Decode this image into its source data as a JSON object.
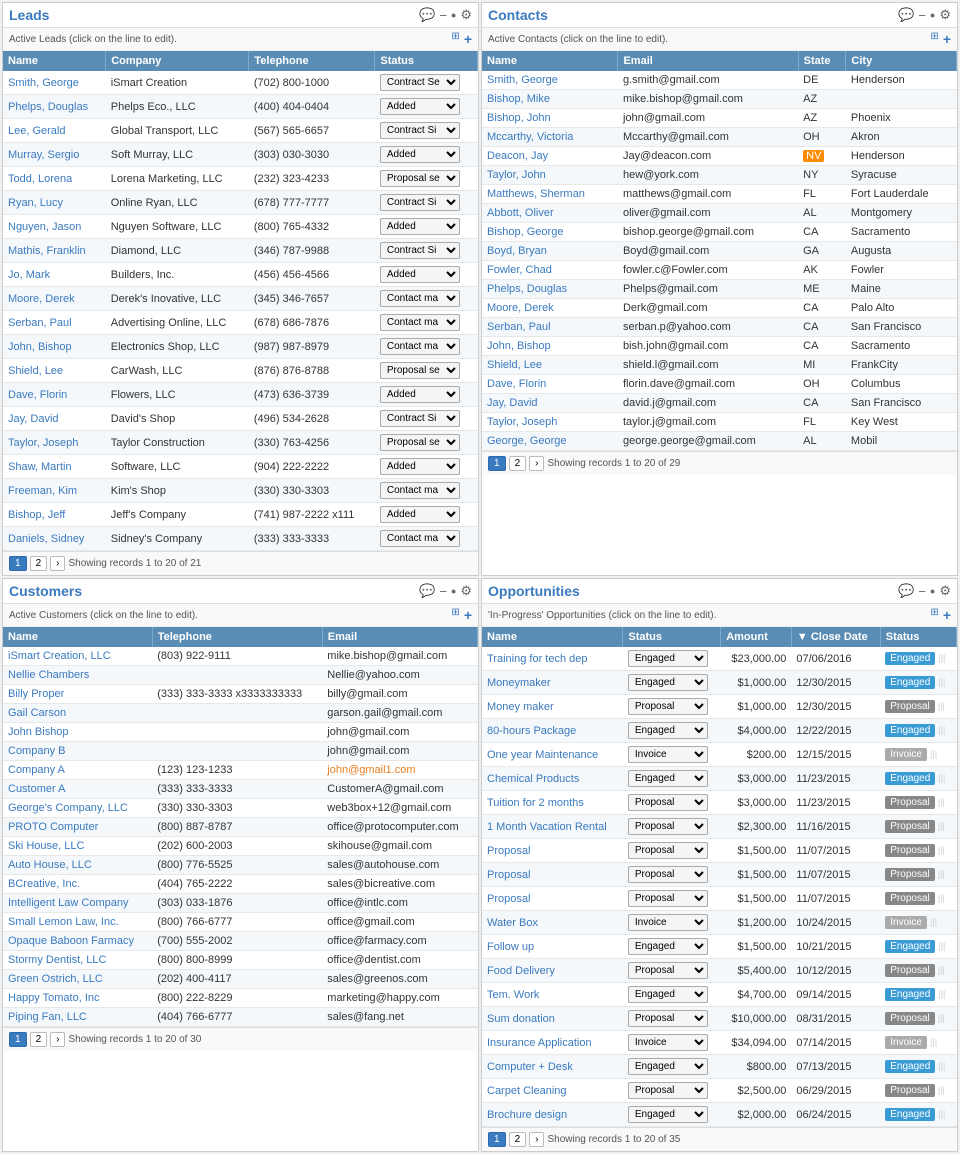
{
  "leads": {
    "title": "Leads",
    "subtitle": "Active Leads (click on the line to edit).",
    "columns": [
      "Name",
      "Company",
      "Telephone",
      "Status"
    ],
    "rows": [
      [
        "Smith, George",
        "iSmart Creation",
        "(702) 800-1000",
        "Contract Se"
      ],
      [
        "Phelps, Douglas",
        "Phelps Eco., LLC",
        "(400) 404-0404",
        "Added"
      ],
      [
        "Lee, Gerald",
        "Global Transport, LLC",
        "(567) 565-6657",
        "Contract Si"
      ],
      [
        "Murray, Sergio",
        "Soft Murray, LLC",
        "(303) 030-3030",
        "Added"
      ],
      [
        "Todd, Lorena",
        "Lorena Marketing, LLC",
        "(232) 323-4233",
        "Proposal se"
      ],
      [
        "Ryan, Lucy",
        "Online Ryan, LLC",
        "(678) 777-7777",
        "Contract Si"
      ],
      [
        "Nguyen, Jason",
        "Nguyen Software, LLC",
        "(800) 765-4332",
        "Added"
      ],
      [
        "Mathis, Franklin",
        "Diamond, LLC",
        "(346) 787-9988",
        "Contract Si"
      ],
      [
        "Jo, Mark",
        "Builders, Inc.",
        "(456) 456-4566",
        "Added"
      ],
      [
        "Moore, Derek",
        "Derek's Inovative, LLC",
        "(345) 346-7657",
        "Contact ma"
      ],
      [
        "Serban, Paul",
        "Advertising Online, LLC",
        "(678) 686-7876",
        "Contact ma"
      ],
      [
        "John, Bishop",
        "Electronics Shop, LLC",
        "(987) 987-8979",
        "Contact ma"
      ],
      [
        "Shield, Lee",
        "CarWash, LLC",
        "(876) 876-8788",
        "Proposal se"
      ],
      [
        "Dave, Florin",
        "Flowers, LLC",
        "(473) 636-3739",
        "Added"
      ],
      [
        "Jay, David",
        "David's Shop",
        "(496) 534-2628",
        "Contract Si"
      ],
      [
        "Taylor, Joseph",
        "Taylor Construction",
        "(330) 763-4256",
        "Proposal se"
      ],
      [
        "Shaw, Martin",
        "Software, LLC",
        "(904) 222-2222",
        "Added"
      ],
      [
        "Freeman, Kim",
        "Kim's Shop",
        "(330) 330-3303",
        "Contact ma"
      ],
      [
        "Bishop, Jeff",
        "Jeff's Company",
        "(741) 987-2222 x111",
        "Added"
      ],
      [
        "Daniels, Sidney",
        "Sidney's Company",
        "(333) 333-3333",
        "Contact ma"
      ]
    ],
    "pagination": "Showing records 1 to 20 of 21"
  },
  "contacts": {
    "title": "Contacts",
    "subtitle": "Active Contacts (click on the line to edit).",
    "columns": [
      "Name",
      "Email",
      "State",
      "City"
    ],
    "rows": [
      [
        "Smith, George",
        "g.smith@gmail.com",
        "DE",
        "Henderson"
      ],
      [
        "Bishop, Mike",
        "mike.bishop@gmail.com",
        "AZ",
        ""
      ],
      [
        "Bishop, John",
        "john@gmail.com",
        "AZ",
        "Phoenix"
      ],
      [
        "Mccarthy, Victoria",
        "Mccarthy@gmail.com",
        "OH",
        "Akron"
      ],
      [
        "Deacon, Jay",
        "Jay@deacon.com",
        "NV",
        "Henderson"
      ],
      [
        "Taylor, John",
        "hew@york.com",
        "NY",
        "Syracuse"
      ],
      [
        "Matthews, Sherman",
        "matthews@gmail.com",
        "FL",
        "Fort Lauderdale"
      ],
      [
        "Abbott, Oliver",
        "oliver@gmail.com",
        "AL",
        "Montgomery"
      ],
      [
        "Bishop, George",
        "bishop.george@gmail.com",
        "CA",
        "Sacramento"
      ],
      [
        "Boyd, Bryan",
        "Boyd@gmail.com",
        "GA",
        "Augusta"
      ],
      [
        "Fowler, Chad",
        "fowler.c@Fowler.com",
        "AK",
        "Fowler"
      ],
      [
        "Phelps, Douglas",
        "Phelps@gmail.com",
        "ME",
        "Maine"
      ],
      [
        "Moore, Derek",
        "Derk@gmail.com",
        "CA",
        "Palo Alto"
      ],
      [
        "Serban, Paul",
        "serban.p@yahoo.com",
        "CA",
        "San Francisco"
      ],
      [
        "John, Bishop",
        "bish.john@gmail.com",
        "CA",
        "Sacramento"
      ],
      [
        "Shield, Lee",
        "shield.l@gmail.com",
        "MI",
        "FrankCity"
      ],
      [
        "Dave, Florin",
        "florin.dave@gmail.com",
        "OH",
        "Columbus"
      ],
      [
        "Jay, David",
        "david.j@gmail.com",
        "CA",
        "San Francisco"
      ],
      [
        "Taylor, Joseph",
        "taylor.j@gmail.com",
        "FL",
        "Key West"
      ],
      [
        "George, George",
        "george.george@gmail.com",
        "AL",
        "Mobil"
      ]
    ],
    "pagination": "Showing records 1 to 20 of 29"
  },
  "customers": {
    "title": "Customers",
    "subtitle": "Active Customers (click on the line to edit).",
    "columns": [
      "Name",
      "Telephone",
      "Email"
    ],
    "rows": [
      [
        "iSmart Creation, LLC",
        "(803) 922-9111",
        "mike.bishop@gmail.com"
      ],
      [
        "Nellie Chambers",
        "",
        "Nellie@yahoo.com"
      ],
      [
        "Billy Proper",
        "(333) 333-3333 x3333333333",
        "billy@gmail.com"
      ],
      [
        "Gail Carson",
        "",
        "garson.gail@gmail.com"
      ],
      [
        "John Bishop",
        "",
        "john@gmail.com"
      ],
      [
        "Company B",
        "",
        "john@gmail.com"
      ],
      [
        "Company A",
        "(123) 123-1233",
        "john@gmail1.com"
      ],
      [
        "Customer A",
        "(333) 333-3333",
        "CustomerA@gmail.com"
      ],
      [
        "George's Company, LLC",
        "(330) 330-3303",
        "web3box+12@gmail.com"
      ],
      [
        "PROTO Computer",
        "(800) 887-8787",
        "office@protocomputer.com"
      ],
      [
        "Ski House, LLC",
        "(202) 600-2003",
        "skihouse@gmail.com"
      ],
      [
        "Auto House, LLC",
        "(800) 776-5525",
        "sales@autohouse.com"
      ],
      [
        "BCreative, Inc.",
        "(404) 765-2222",
        "sales@bicreative.com"
      ],
      [
        "Intelligent Law Company",
        "(303) 033-1876",
        "office@intlc.com"
      ],
      [
        "Small Lemon Law, Inc.",
        "(800) 766-6777",
        "office@gmail.com"
      ],
      [
        "Opaque Baboon Farmacy",
        "(700) 555-2002",
        "office@farmacy.com"
      ],
      [
        "Stormy Dentist, LLC",
        "(800) 800-8999",
        "office@dentist.com"
      ],
      [
        "Green Ostrich, LLC",
        "(202) 400-4117",
        "sales@greenos.com"
      ],
      [
        "Happy Tomato, Inc",
        "(800) 222-8229",
        "marketing@happy.com"
      ],
      [
        "Piping Fan, LLC",
        "(404) 766-6777",
        "sales@fang.net"
      ]
    ],
    "pagination": "Showing records 1 to 20 of 30"
  },
  "opportunities": {
    "title": "Opportunities",
    "subtitle": "'In-Progress' Opportunities (click on the line to edit).",
    "columns": [
      "Name",
      "Status",
      "Amount",
      "Close Date",
      "Status"
    ],
    "rows": [
      [
        "Training for tech dep",
        "Engaged",
        "$23,000.00",
        "07/06/2016",
        "Engaged"
      ],
      [
        "Moneymaker",
        "Engaged",
        "$1,000.00",
        "12/30/2015",
        "Engaged"
      ],
      [
        "Money maker",
        "Proposal",
        "$1,000.00",
        "12/30/2015",
        "Proposal"
      ],
      [
        "80-hours Package",
        "Engaged",
        "$4,000.00",
        "12/22/2015",
        "Engaged"
      ],
      [
        "One year Maintenance",
        "Invoice",
        "$200.00",
        "12/15/2015",
        "Invoice"
      ],
      [
        "Chemical Products",
        "Engaged",
        "$3,000.00",
        "11/23/2015",
        "Engaged"
      ],
      [
        "Tuition for 2 months",
        "Proposal",
        "$3,000.00",
        "11/23/2015",
        "Proposal"
      ],
      [
        "1 Month Vacation Rental",
        "Proposal",
        "$2,300.00",
        "11/16/2015",
        "Proposal"
      ],
      [
        "Proposal",
        "Proposal",
        "$1,500.00",
        "11/07/2015",
        "Proposal"
      ],
      [
        "Proposal",
        "Proposal",
        "$1,500.00",
        "11/07/2015",
        "Proposal"
      ],
      [
        "Proposal",
        "Proposal",
        "$1,500.00",
        "11/07/2015",
        "Proposal"
      ],
      [
        "Water Box",
        "Invoice",
        "$1,200.00",
        "10/24/2015",
        "Invoice"
      ],
      [
        "Follow up",
        "Engaged",
        "$1,500.00",
        "10/21/2015",
        "Engaged"
      ],
      [
        "Food Delivery",
        "Proposal",
        "$5,400.00",
        "10/12/2015",
        "Proposal"
      ],
      [
        "Tem. Work",
        "Engaged",
        "$4,700.00",
        "09/14/2015",
        "Engaged"
      ],
      [
        "Sum donation",
        "Proposal",
        "$10,000.00",
        "08/31/2015",
        "Proposal"
      ],
      [
        "Insurance Application",
        "Invoice",
        "$34,094.00",
        "07/14/2015",
        "Invoice"
      ],
      [
        "Computer + Desk",
        "Engaged",
        "$800.00",
        "07/13/2015",
        "Engaged"
      ],
      [
        "Carpet Cleaning",
        "Proposal",
        "$2,500.00",
        "06/29/2015",
        "Proposal"
      ],
      [
        "Brochure design",
        "Engaged",
        "$2,000.00",
        "06/24/2015",
        "Engaged"
      ]
    ],
    "pagination": "Showing records 1 to 20 of 35"
  }
}
